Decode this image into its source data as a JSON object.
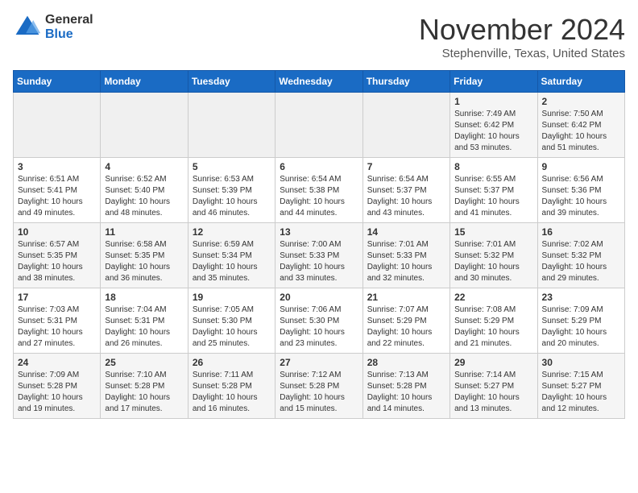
{
  "header": {
    "logo_general": "General",
    "logo_blue": "Blue",
    "title": "November 2024",
    "location": "Stephenville, Texas, United States"
  },
  "weekdays": [
    "Sunday",
    "Monday",
    "Tuesday",
    "Wednesday",
    "Thursday",
    "Friday",
    "Saturday"
  ],
  "weeks": [
    [
      {
        "day": "",
        "empty": true
      },
      {
        "day": "",
        "empty": true
      },
      {
        "day": "",
        "empty": true
      },
      {
        "day": "",
        "empty": true
      },
      {
        "day": "",
        "empty": true
      },
      {
        "day": "1",
        "sunrise": "7:49 AM",
        "sunset": "6:42 PM",
        "daylight": "10 hours and 53 minutes."
      },
      {
        "day": "2",
        "sunrise": "7:50 AM",
        "sunset": "6:42 PM",
        "daylight": "10 hours and 51 minutes."
      }
    ],
    [
      {
        "day": "3",
        "sunrise": "6:51 AM",
        "sunset": "5:41 PM",
        "daylight": "10 hours and 49 minutes."
      },
      {
        "day": "4",
        "sunrise": "6:52 AM",
        "sunset": "5:40 PM",
        "daylight": "10 hours and 48 minutes."
      },
      {
        "day": "5",
        "sunrise": "6:53 AM",
        "sunset": "5:39 PM",
        "daylight": "10 hours and 46 minutes."
      },
      {
        "day": "6",
        "sunrise": "6:54 AM",
        "sunset": "5:38 PM",
        "daylight": "10 hours and 44 minutes."
      },
      {
        "day": "7",
        "sunrise": "6:54 AM",
        "sunset": "5:37 PM",
        "daylight": "10 hours and 43 minutes."
      },
      {
        "day": "8",
        "sunrise": "6:55 AM",
        "sunset": "5:37 PM",
        "daylight": "10 hours and 41 minutes."
      },
      {
        "day": "9",
        "sunrise": "6:56 AM",
        "sunset": "5:36 PM",
        "daylight": "10 hours and 39 minutes."
      }
    ],
    [
      {
        "day": "10",
        "sunrise": "6:57 AM",
        "sunset": "5:35 PM",
        "daylight": "10 hours and 38 minutes."
      },
      {
        "day": "11",
        "sunrise": "6:58 AM",
        "sunset": "5:35 PM",
        "daylight": "10 hours and 36 minutes."
      },
      {
        "day": "12",
        "sunrise": "6:59 AM",
        "sunset": "5:34 PM",
        "daylight": "10 hours and 35 minutes."
      },
      {
        "day": "13",
        "sunrise": "7:00 AM",
        "sunset": "5:33 PM",
        "daylight": "10 hours and 33 minutes."
      },
      {
        "day": "14",
        "sunrise": "7:01 AM",
        "sunset": "5:33 PM",
        "daylight": "10 hours and 32 minutes."
      },
      {
        "day": "15",
        "sunrise": "7:01 AM",
        "sunset": "5:32 PM",
        "daylight": "10 hours and 30 minutes."
      },
      {
        "day": "16",
        "sunrise": "7:02 AM",
        "sunset": "5:32 PM",
        "daylight": "10 hours and 29 minutes."
      }
    ],
    [
      {
        "day": "17",
        "sunrise": "7:03 AM",
        "sunset": "5:31 PM",
        "daylight": "10 hours and 27 minutes."
      },
      {
        "day": "18",
        "sunrise": "7:04 AM",
        "sunset": "5:31 PM",
        "daylight": "10 hours and 26 minutes."
      },
      {
        "day": "19",
        "sunrise": "7:05 AM",
        "sunset": "5:30 PM",
        "daylight": "10 hours and 25 minutes."
      },
      {
        "day": "20",
        "sunrise": "7:06 AM",
        "sunset": "5:30 PM",
        "daylight": "10 hours and 23 minutes."
      },
      {
        "day": "21",
        "sunrise": "7:07 AM",
        "sunset": "5:29 PM",
        "daylight": "10 hours and 22 minutes."
      },
      {
        "day": "22",
        "sunrise": "7:08 AM",
        "sunset": "5:29 PM",
        "daylight": "10 hours and 21 minutes."
      },
      {
        "day": "23",
        "sunrise": "7:09 AM",
        "sunset": "5:29 PM",
        "daylight": "10 hours and 20 minutes."
      }
    ],
    [
      {
        "day": "24",
        "sunrise": "7:09 AM",
        "sunset": "5:28 PM",
        "daylight": "10 hours and 19 minutes."
      },
      {
        "day": "25",
        "sunrise": "7:10 AM",
        "sunset": "5:28 PM",
        "daylight": "10 hours and 17 minutes."
      },
      {
        "day": "26",
        "sunrise": "7:11 AM",
        "sunset": "5:28 PM",
        "daylight": "10 hours and 16 minutes."
      },
      {
        "day": "27",
        "sunrise": "7:12 AM",
        "sunset": "5:28 PM",
        "daylight": "10 hours and 15 minutes."
      },
      {
        "day": "28",
        "sunrise": "7:13 AM",
        "sunset": "5:28 PM",
        "daylight": "10 hours and 14 minutes."
      },
      {
        "day": "29",
        "sunrise": "7:14 AM",
        "sunset": "5:27 PM",
        "daylight": "10 hours and 13 minutes."
      },
      {
        "day": "30",
        "sunrise": "7:15 AM",
        "sunset": "5:27 PM",
        "daylight": "10 hours and 12 minutes."
      }
    ]
  ]
}
